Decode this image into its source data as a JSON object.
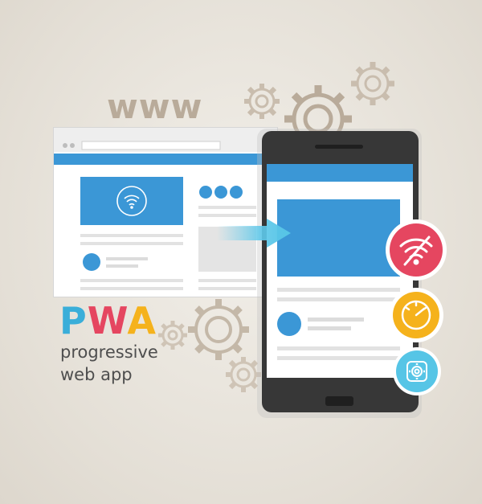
{
  "headline": "www",
  "brand": {
    "letter_p": "P",
    "letter_w": "W",
    "letter_a": "A"
  },
  "tagline": {
    "line1": "progressive",
    "line2": "web app"
  },
  "icons": [
    "gear-icon",
    "wifi-icon",
    "wifi-off-icon",
    "speedometer-icon",
    "settings-icon",
    "arrow-right-icon"
  ],
  "colors": {
    "browser_blue": "#3b97d6",
    "phone_body": "#373737",
    "offline_red": "#e54660",
    "speed_yellow": "#f5b21c",
    "settings_cyan": "#56c5e6",
    "gear_outline": "#b9ab9a"
  }
}
